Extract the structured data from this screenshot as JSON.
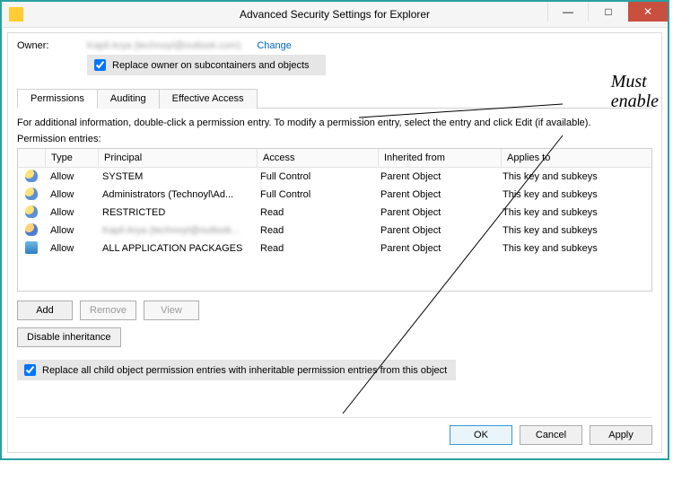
{
  "window": {
    "title": "Advanced Security Settings for Explorer"
  },
  "owner": {
    "label": "Owner:",
    "name": "Kapil Arya (technoyl@outlook.com)",
    "change_label": "Change",
    "replace_owner_label": "Replace owner on subcontainers and objects",
    "replace_owner_checked": true
  },
  "tabs": [
    "Permissions",
    "Auditing",
    "Effective Access"
  ],
  "active_tab": 0,
  "info_text": "For additional information, double-click a permission entry. To modify a permission entry, select the entry and click Edit (if available).",
  "entries_label": "Permission entries:",
  "columns": {
    "type": "Type",
    "principal": "Principal",
    "access": "Access",
    "inherited": "Inherited from",
    "applies": "Applies to"
  },
  "rows": [
    {
      "icon": "users",
      "type": "Allow",
      "principal": "SYSTEM",
      "access": "Full Control",
      "inherited": "Parent Object",
      "applies": "This key and subkeys",
      "blurred": false
    },
    {
      "icon": "users",
      "type": "Allow",
      "principal": "Administrators (Technoyl\\Ad...",
      "access": "Full Control",
      "inherited": "Parent Object",
      "applies": "This key and subkeys",
      "blurred": false
    },
    {
      "icon": "users",
      "type": "Allow",
      "principal": "RESTRICTED",
      "access": "Read",
      "inherited": "Parent Object",
      "applies": "This key and subkeys",
      "blurred": false
    },
    {
      "icon": "user",
      "type": "Allow",
      "principal": "Kapil Arya (technoyl@outlook...",
      "access": "Read",
      "inherited": "Parent Object",
      "applies": "This key and subkeys",
      "blurred": true
    },
    {
      "icon": "pkg",
      "type": "Allow",
      "principal": "ALL APPLICATION PACKAGES",
      "access": "Read",
      "inherited": "Parent Object",
      "applies": "This key and subkeys",
      "blurred": false
    }
  ],
  "buttons": {
    "add": "Add",
    "remove": "Remove",
    "view": "View",
    "disable_inheritance": "Disable inheritance",
    "ok": "OK",
    "cancel": "Cancel",
    "apply": "Apply"
  },
  "replace_child": {
    "label": "Replace all child object permission entries with inheritable permission entries from this object",
    "checked": true
  },
  "annotation": {
    "line1": "Must",
    "line2": "enable"
  }
}
